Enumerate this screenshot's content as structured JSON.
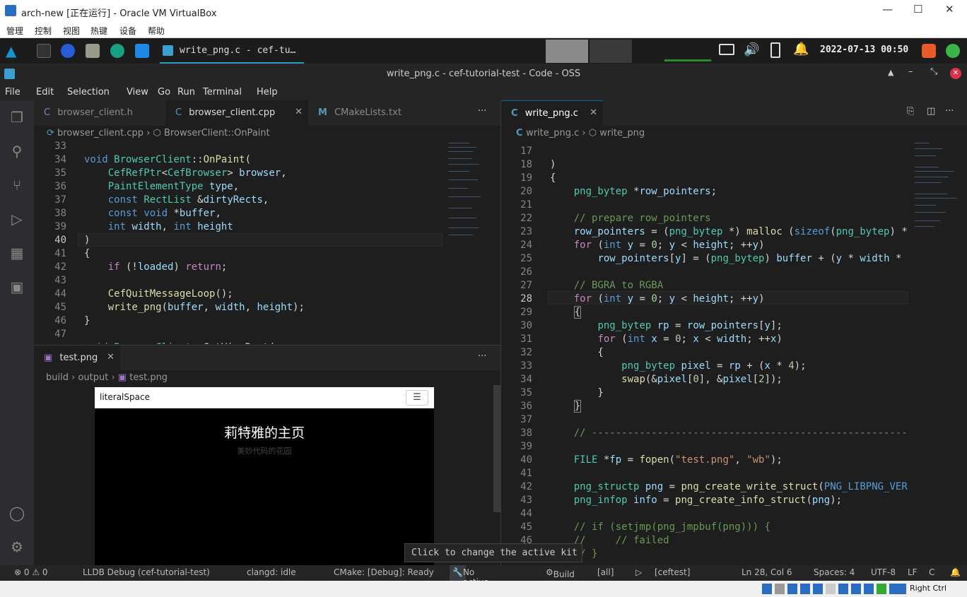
{
  "vbox": {
    "title": "arch-new [正在运行] - Oracle VM VirtualBox",
    "menu": [
      "管理",
      "控制",
      "视图",
      "热键",
      "设备",
      "帮助"
    ],
    "status_host_key": "Right Ctrl"
  },
  "panel": {
    "active_task": "write_png.c - cef-tu…",
    "clock": "2022-07-13 00:50"
  },
  "window": {
    "title": "write_png.c - cef-tutorial-test - Code - OSS"
  },
  "menubar": [
    "File",
    "Edit",
    "Selection",
    "View",
    "Go",
    "Run",
    "Terminal",
    "Help"
  ],
  "left_editor": {
    "tabs": [
      {
        "label": "browser_client.h",
        "icon": "C"
      },
      {
        "label": "browser_client.cpp",
        "icon": "C"
      },
      {
        "label": "CMakeLists.txt",
        "icon": "M"
      }
    ],
    "breadcrumb": [
      "browser_client.cpp",
      "BrowserClient::OnPaint"
    ],
    "line_numbers": [
      "33",
      "34",
      "35",
      "36",
      "37",
      "38",
      "39",
      "40",
      "41",
      "42",
      "43",
      "44",
      "45",
      "46",
      "47"
    ]
  },
  "preview": {
    "tab": "test.png",
    "breadcrumb": [
      "build",
      "output",
      "test.png"
    ],
    "site_name": "literalSpace",
    "heading": "莉特雅的主页",
    "subheading": "美妙代码的花园"
  },
  "right_editor": {
    "tab": "write_png.c",
    "breadcrumb": [
      "write_png.c",
      "write_png"
    ],
    "line_numbers": [
      "17",
      "18",
      "19",
      "20",
      "21",
      "22",
      "23",
      "24",
      "25",
      "26",
      "27",
      "28",
      "29",
      "30",
      "31",
      "32",
      "33",
      "34",
      "35",
      "36",
      "37",
      "38",
      "39",
      "40",
      "41",
      "42",
      "43",
      "44",
      "45",
      "46"
    ]
  },
  "tooltip": "Click to change the active kit",
  "status": {
    "problems": "⊗ 0  ⚠ 0",
    "debug": "LLDB Debug (cef-tutorial-test)",
    "clangd": "clangd: idle",
    "cmake": "CMake: [Debug]: Ready",
    "kit": "No active kit",
    "build": "Build",
    "target": "[all]",
    "launch": "[ceftest]",
    "position": "Ln 28, Col 6",
    "spaces": "Spaces: 4",
    "encoding": "UTF-8",
    "eol": "LF",
    "lang": "C"
  },
  "colors": {
    "accent": "#0e639c",
    "keyword": "#c586c0",
    "type": "#4ec9b0",
    "function": "#dcdcaa",
    "string": "#ce9178"
  }
}
